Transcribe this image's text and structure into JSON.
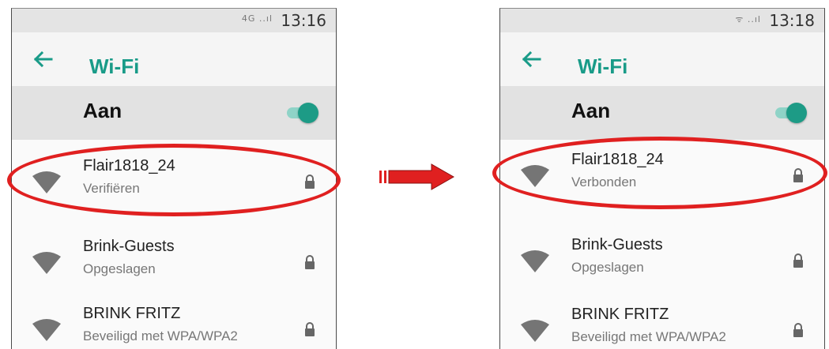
{
  "colors": {
    "accent": "#199b88",
    "highlight": "#e02020"
  },
  "screens": [
    {
      "status_icons": "4G ..ıl",
      "time": "13:16",
      "title": "Wi-Fi",
      "toggle_label": "Aan",
      "toggle_on": true,
      "networks": [
        {
          "ssid": "Flair1818_24",
          "status": "Verifiëren",
          "icon": "wifi-icon",
          "locked": true
        },
        {
          "ssid": "Brink-Guests",
          "status": "Opgeslagen",
          "icon": "wifi-icon",
          "locked": true
        },
        {
          "ssid": "BRINK FRITZ",
          "status": "Beveiligd met WPA/WPA2",
          "icon": "wifi-icon",
          "locked": true
        }
      ]
    },
    {
      "status_icons": "ᯤ ..ıl",
      "time": "13:18",
      "title": "Wi-Fi",
      "toggle_label": "Aan",
      "toggle_on": true,
      "networks": [
        {
          "ssid": "Flair1818_24",
          "status": "Verbonden",
          "icon": "wifi-icon",
          "locked": true
        },
        {
          "ssid": "Brink-Guests",
          "status": "Opgeslagen",
          "icon": "wifi-icon",
          "locked": true
        },
        {
          "ssid": "BRINK FRITZ",
          "status": "Beveiligd met WPA/WPA2",
          "icon": "wifi-icon",
          "locked": true
        }
      ]
    }
  ]
}
